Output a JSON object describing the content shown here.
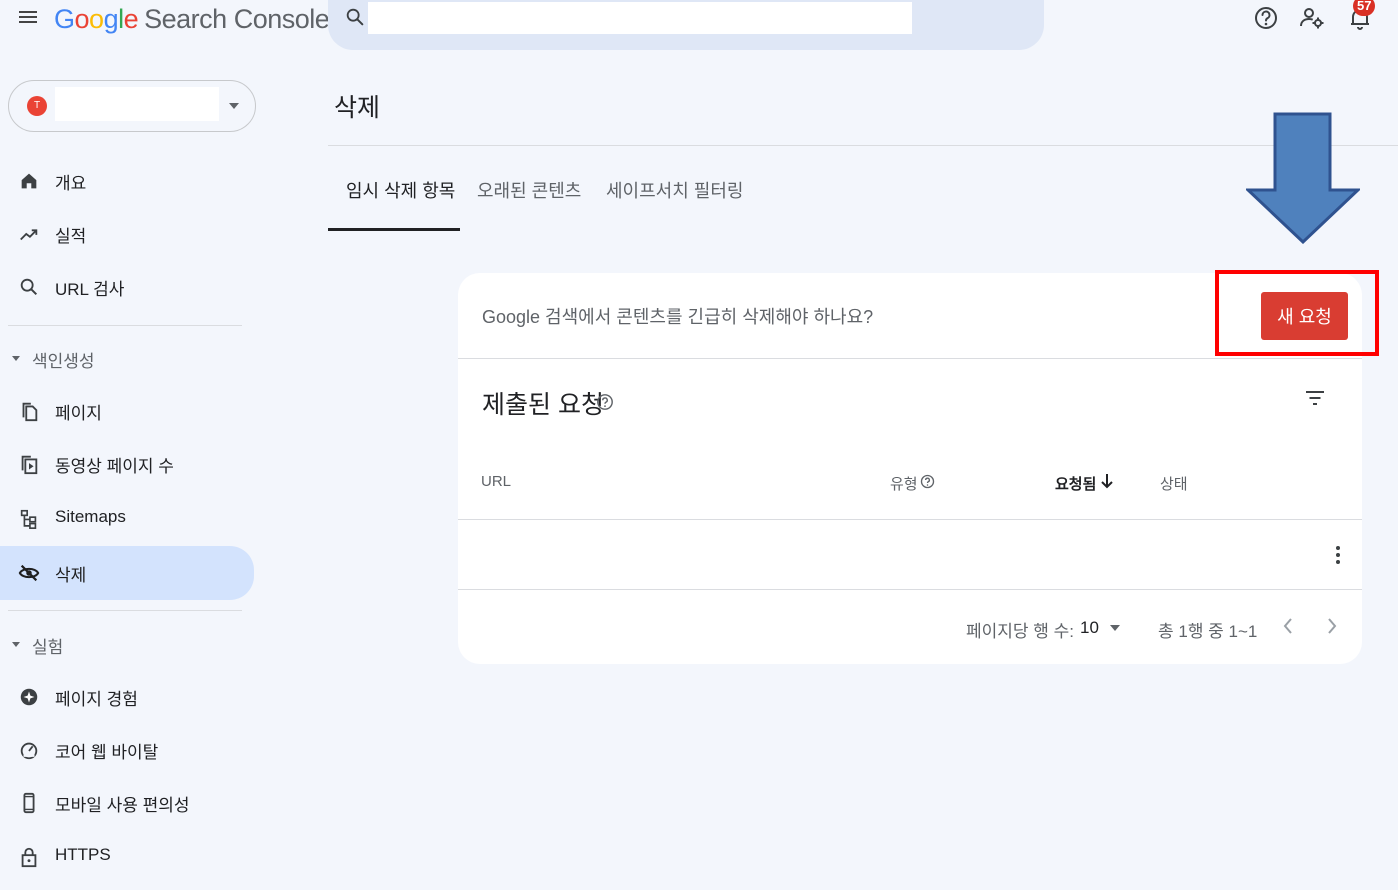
{
  "app": {
    "logo_letters": [
      "G",
      "o",
      "o",
      "g",
      "l",
      "e"
    ],
    "product_name": "Search Console",
    "notification_count": "57",
    "property_favicon_letter": "T"
  },
  "search": {
    "placeholder": "",
    "value": ""
  },
  "sidebar": {
    "items": [
      {
        "label": "개요",
        "icon": "home-icon"
      },
      {
        "label": "실적",
        "icon": "trending-up-icon"
      },
      {
        "label": "URL 검사",
        "icon": "search-icon"
      }
    ],
    "section_indexing": "색인생성",
    "indexing_items": [
      {
        "label": "페이지",
        "icon": "pages-icon"
      },
      {
        "label": "동영상 페이지 수",
        "icon": "video-pages-icon"
      },
      {
        "label": "Sitemaps",
        "icon": "sitemap-icon"
      },
      {
        "label": "삭제",
        "icon": "visibility-off-icon",
        "active": true
      }
    ],
    "section_experience": "실험",
    "experience_items": [
      {
        "label": "페이지 경험",
        "icon": "page-experience-icon"
      },
      {
        "label": "코어 웹 바이탈",
        "icon": "speed-gauge-icon"
      },
      {
        "label": "모바일 사용 편의성",
        "icon": "smartphone-icon"
      },
      {
        "label": "HTTPS",
        "icon": "lock-icon"
      }
    ]
  },
  "main": {
    "title": "삭제",
    "tabs": [
      {
        "label": "임시 삭제 항목",
        "active": true
      },
      {
        "label": "오래된 콘텐츠",
        "active": false
      },
      {
        "label": "세이프서치 필터링",
        "active": false
      }
    ],
    "card": {
      "question": "Google 검색에서 콘텐츠를 긴급히 삭제해야 하나요?",
      "new_request_label": "새 요청",
      "section_title": "제출된 요청",
      "columns": {
        "url": "URL",
        "type": "유형",
        "requested": "요청됨",
        "status": "상태"
      },
      "rows": [
        {
          "url": "",
          "type": "",
          "requested": "",
          "status": ""
        }
      ],
      "pagination": {
        "rows_per_page_label": "페이지당 행 수:",
        "rows_per_page_value": "10",
        "range_text": "총 1행 중 1~1"
      }
    }
  },
  "colors": {
    "accent_button": "#d93d32",
    "active_nav_bg": "#d3e3fd",
    "annotation_arrow": "#4f81bd",
    "annotation_box": "#ff0000",
    "page_bg": "#f3f6fc"
  }
}
